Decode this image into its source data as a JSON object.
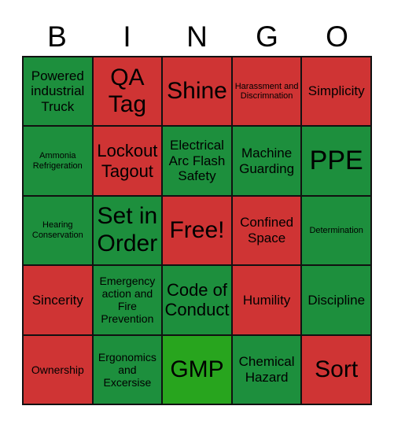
{
  "header": [
    "B",
    "I",
    "N",
    "G",
    "O"
  ],
  "colors": {
    "red": "#cf3434",
    "green": "#1d8f3d",
    "free_green": "#28a51e"
  },
  "cells": [
    {
      "text": "Powered industrial Truck",
      "color": "green",
      "size": "md"
    },
    {
      "text": "QA Tag",
      "color": "red",
      "size": "xl"
    },
    {
      "text": "Shine",
      "color": "red",
      "size": "xl"
    },
    {
      "text": "Harassment and Discrimnation",
      "color": "red",
      "size": "xs"
    },
    {
      "text": "Simplicity",
      "color": "red",
      "size": "md"
    },
    {
      "text": "Ammonia Refrigeration",
      "color": "green",
      "size": "xs"
    },
    {
      "text": "Lockout Tagout",
      "color": "red",
      "size": "lg"
    },
    {
      "text": "Electrical Arc Flash Safety",
      "color": "green",
      "size": "md"
    },
    {
      "text": "Machine Guarding",
      "color": "green",
      "size": "md"
    },
    {
      "text": "PPE",
      "color": "green",
      "size": "xxl"
    },
    {
      "text": "Hearing Conservation",
      "color": "green",
      "size": "xs"
    },
    {
      "text": "Set in Order",
      "color": "green",
      "size": "xl"
    },
    {
      "text": "Free!",
      "color": "red",
      "size": "xl"
    },
    {
      "text": "Confined Space",
      "color": "red",
      "size": "md"
    },
    {
      "text": "Determination",
      "color": "green",
      "size": "xs"
    },
    {
      "text": "Sincerity",
      "color": "red",
      "size": "md"
    },
    {
      "text": "Emergency action and Fire Prevention",
      "color": "green",
      "size": "sm"
    },
    {
      "text": "Code of Conduct",
      "color": "green",
      "size": "lg"
    },
    {
      "text": "Humility",
      "color": "red",
      "size": "md"
    },
    {
      "text": "Discipline",
      "color": "green",
      "size": "md"
    },
    {
      "text": "Ownership",
      "color": "red",
      "size": "sm"
    },
    {
      "text": "Ergonomics and Excersise",
      "color": "green",
      "size": "sm"
    },
    {
      "text": "GMP",
      "color": "lime",
      "size": "xl"
    },
    {
      "text": "Chemical Hazard",
      "color": "green",
      "size": "md"
    },
    {
      "text": "Sort",
      "color": "red",
      "size": "xl"
    }
  ]
}
